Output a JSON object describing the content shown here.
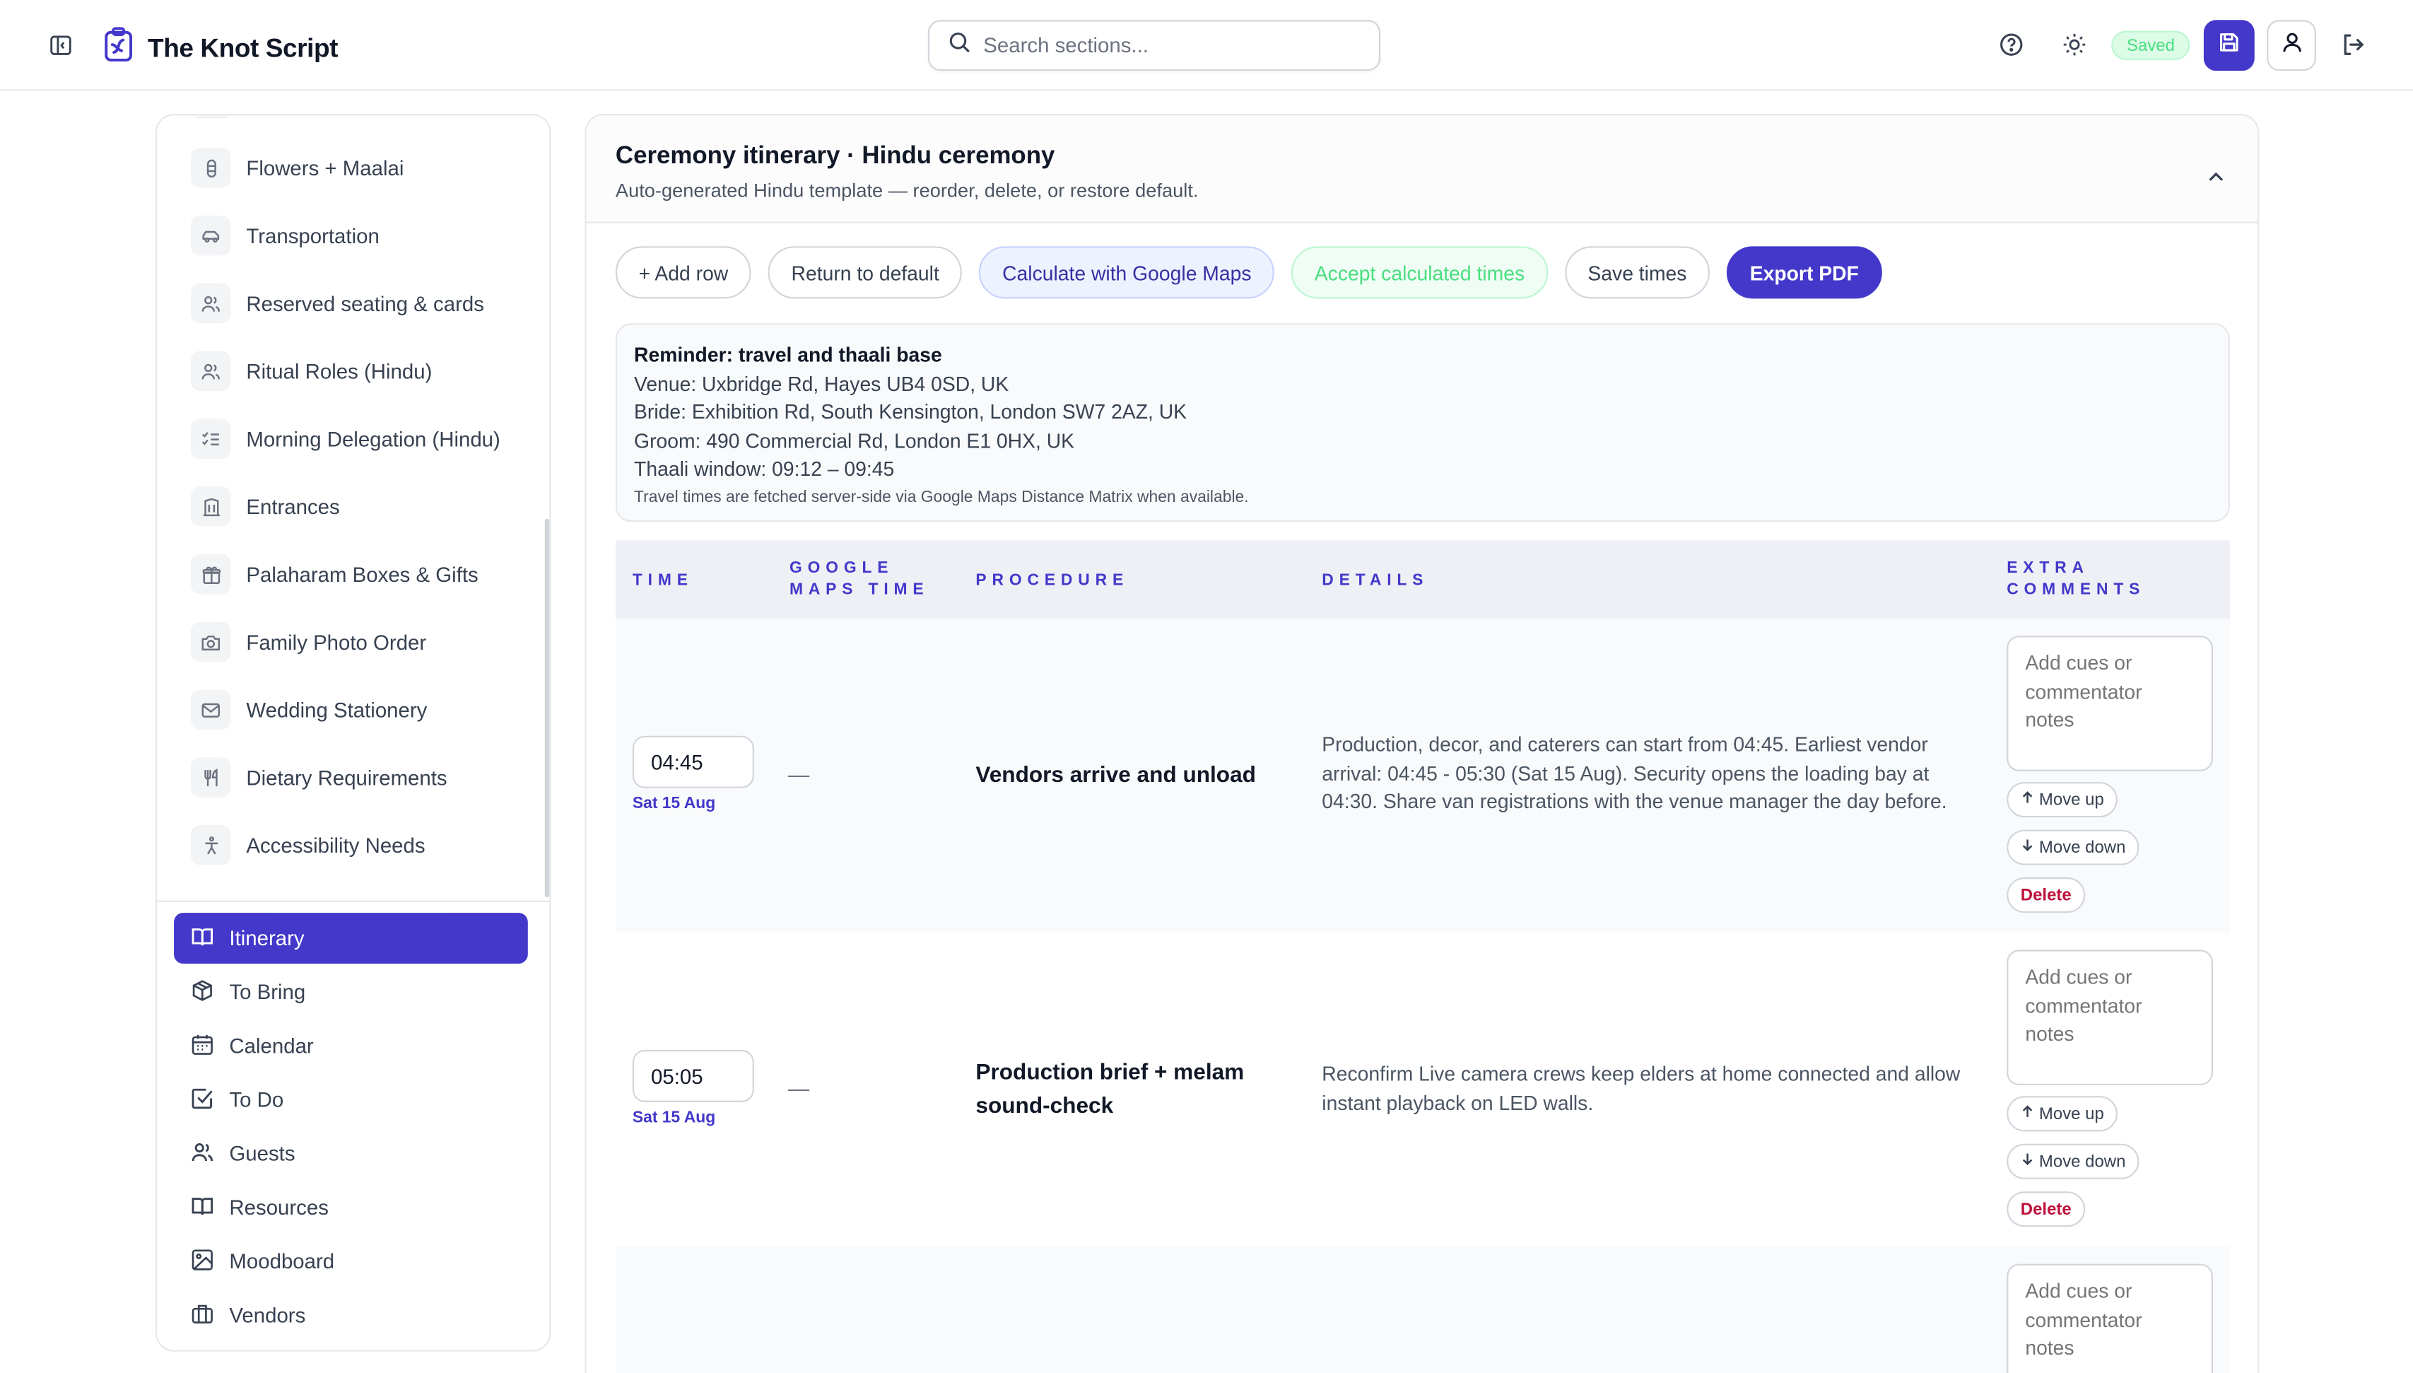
{
  "header": {
    "title": "The Knot Script",
    "search_placeholder": "Search sections...",
    "saved_label": "Saved"
  },
  "sidebar": {
    "sections": [
      {
        "label": "Flowers + Maalai",
        "icon": "flower-icon"
      },
      {
        "label": "Transportation",
        "icon": "car-icon"
      },
      {
        "label": "Reserved seating & cards",
        "icon": "users-icon"
      },
      {
        "label": "Ritual Roles (Hindu)",
        "icon": "users-icon"
      },
      {
        "label": "Morning Delegation (Hindu)",
        "icon": "checklist-icon"
      },
      {
        "label": "Entrances",
        "icon": "building-icon"
      },
      {
        "label": "Palaharam Boxes & Gifts",
        "icon": "gift-icon"
      },
      {
        "label": "Family Photo Order",
        "icon": "camera-icon"
      },
      {
        "label": "Wedding Stationery",
        "icon": "mail-icon"
      },
      {
        "label": "Dietary Requirements",
        "icon": "utensils-icon"
      },
      {
        "label": "Accessibility Needs",
        "icon": "accessibility-icon"
      }
    ],
    "nav": [
      {
        "label": "Itinerary",
        "icon": "book-icon",
        "active": true
      },
      {
        "label": "To Bring",
        "icon": "package-icon"
      },
      {
        "label": "Calendar",
        "icon": "calendar-icon"
      },
      {
        "label": "To Do",
        "icon": "check-square-icon"
      },
      {
        "label": "Guests",
        "icon": "users-icon"
      },
      {
        "label": "Resources",
        "icon": "book-open-icon"
      },
      {
        "label": "Moodboard",
        "icon": "image-icon"
      },
      {
        "label": "Vendors",
        "icon": "briefcase-icon"
      }
    ]
  },
  "main": {
    "title": "Ceremony itinerary · Hindu ceremony",
    "subtitle": "Auto-generated Hindu template — reorder, delete, or restore default.",
    "toolbar": {
      "add_row": "+ Add row",
      "return_default": "Return to default",
      "calc_maps": "Calculate with Google Maps",
      "accept_times": "Accept calculated times",
      "save_times": "Save times",
      "export_pdf": "Export PDF"
    },
    "reminder": {
      "title": "Reminder: travel and thaali base",
      "venue": "Venue: Uxbridge Rd, Hayes UB4 0SD, UK",
      "bride": "Bride: Exhibition Rd, South Kensington, London SW7 2AZ, UK",
      "groom": "Groom: 490 Commercial Rd, London E1 0HX, UK",
      "thaali": "Thaali window: 09:12 – 09:45",
      "note": "Travel times are fetched server-side via Google Maps Distance Matrix when available."
    },
    "table": {
      "headers": {
        "time": "TIME",
        "maps_line1": "GOOGLE",
        "maps_line2": "MAPS TIME",
        "procedure": "PROCEDURE",
        "details": "DETAILS",
        "comments_line1": "EXTRA",
        "comments_line2": "COMMENTS"
      },
      "comment_placeholder": "Add cues or commentator notes",
      "move_up": "Move up",
      "move_down": "Move down",
      "delete": "Delete",
      "rows": [
        {
          "time": "04:45",
          "date": "Sat 15 Aug",
          "maps_time": "—",
          "procedure": "Vendors arrive and unload",
          "details": "Production, decor, and caterers can start from 04:45. Earliest vendor arrival: 04:45 - 05:30 (Sat 15 Aug). Security opens the loading bay at 04:30. Share van registrations with the venue manager the day before."
        },
        {
          "time": "05:05",
          "date": "Sat 15 Aug",
          "maps_time": "—",
          "procedure": "Production brief + melam sound-check",
          "details": "Reconfirm Live camera crews keep elders at home connected and allow instant playback on LED walls."
        }
      ]
    }
  },
  "colors": {
    "accent": "#4338ca",
    "saved_green": "#4ade80",
    "delete_red": "#be123c"
  }
}
